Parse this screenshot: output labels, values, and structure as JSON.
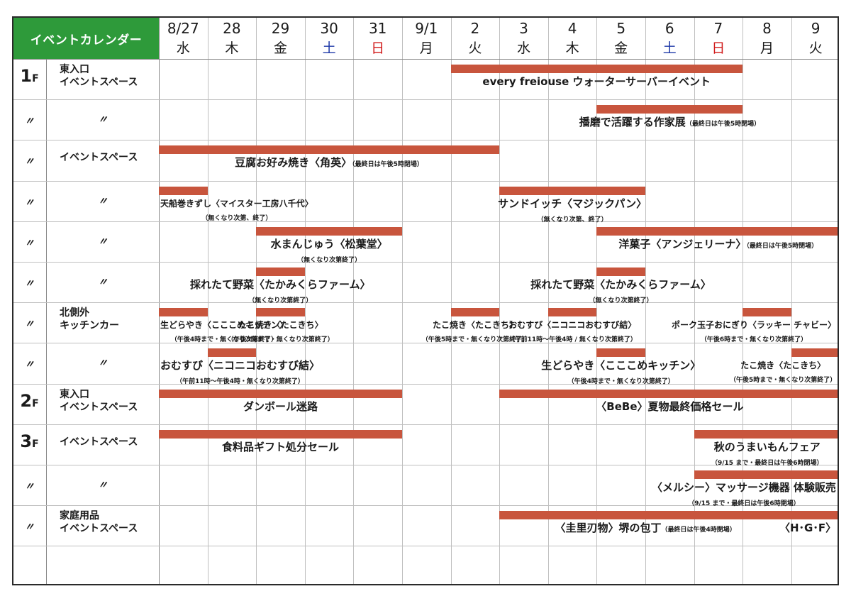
{
  "title": "イベントカレンダー",
  "days": [
    {
      "num": "8/27",
      "dow": "水",
      "color": "#1a1a1a"
    },
    {
      "num": "28",
      "dow": "木",
      "color": "#1a1a1a"
    },
    {
      "num": "29",
      "dow": "金",
      "color": "#1a1a1a"
    },
    {
      "num": "30",
      "dow": "土",
      "color": "#1f3aa8"
    },
    {
      "num": "31",
      "dow": "日",
      "color": "#d01818"
    },
    {
      "num": "9/1",
      "dow": "月",
      "color": "#1a1a1a"
    },
    {
      "num": "2",
      "dow": "火",
      "color": "#1a1a1a"
    },
    {
      "num": "3",
      "dow": "水",
      "color": "#1a1a1a"
    },
    {
      "num": "4",
      "dow": "木",
      "color": "#1a1a1a"
    },
    {
      "num": "5",
      "dow": "金",
      "color": "#1a1a1a"
    },
    {
      "num": "6",
      "dow": "土",
      "color": "#1f3aa8"
    },
    {
      "num": "7",
      "dow": "日",
      "color": "#d01818"
    },
    {
      "num": "8",
      "dow": "月",
      "color": "#1a1a1a"
    },
    {
      "num": "9",
      "dow": "火",
      "color": "#1a1a1a"
    }
  ],
  "rows": [
    {
      "floor": "1",
      "floor_unit": "F",
      "location": "東入口\nイベントスペース"
    },
    {
      "floor": "〃",
      "location": "〃"
    },
    {
      "floor": "〃",
      "location": "イベントスペース"
    },
    {
      "floor": "〃",
      "location": "〃"
    },
    {
      "floor": "〃",
      "location": "〃"
    },
    {
      "floor": "〃",
      "location": "〃"
    },
    {
      "floor": "〃",
      "location": "北側外\nキッチンカー"
    },
    {
      "floor": "〃",
      "location": "〃"
    },
    {
      "floor": "2",
      "floor_unit": "F",
      "location": "東入口\nイベントスペース"
    },
    {
      "floor": "3",
      "floor_unit": "F",
      "location": "イベントスペース"
    },
    {
      "floor": "〃",
      "location": "〃"
    },
    {
      "floor": "〃",
      "location": "家庭用品\nイベントスペース"
    }
  ],
  "bar_color": "#c8553d",
  "events": [
    {
      "row": 0,
      "start": 6,
      "end": 12,
      "label": "every freiouse ウォーターサーバーイベント"
    },
    {
      "row": 1,
      "start": 9,
      "end": 12,
      "label": "播磨で活躍する作家展",
      "note": "（最終日は午後5時閉場）"
    },
    {
      "row": 2,
      "start": 0,
      "end": 7,
      "label": "豆腐お好み焼き〈角英〉",
      "note": "（最終日は午後5時閉場）"
    },
    {
      "row": 3,
      "start": 0,
      "end": 1,
      "label": "天船巻きずし〈マイスター工房八千代〉",
      "sub": "（無くなり次第、終了）",
      "small": true
    },
    {
      "row": 3,
      "start": 7,
      "end": 10,
      "label": "サンドイッチ〈マジックパン〉",
      "sub": "（無くなり次第、終了）"
    },
    {
      "row": 4,
      "start": 2,
      "end": 5,
      "label": "水まんじゅう〈松葉堂〉",
      "sub": "（無くなり次第終了）"
    },
    {
      "row": 4,
      "start": 9,
      "end": 14,
      "label": "洋菓子〈アンジェリーナ〉",
      "note": "（最終日は午後5時閉場）"
    },
    {
      "row": 5,
      "start": 2,
      "end": 3,
      "label": "採れたて野菜〈たかみくらファーム〉",
      "sub": "（無くなり次第終了）"
    },
    {
      "row": 5,
      "start": 9,
      "end": 10,
      "label": "採れたて野菜〈たかみくらファーム〉",
      "sub": "（無くなり次第終了）"
    },
    {
      "row": 6,
      "start": 0,
      "end": 1,
      "label": "生どらやき〈こここめキッチン〉",
      "sub": "（午後4時まで・無くなり次第終了）",
      "small": true
    },
    {
      "row": 6,
      "start": 2,
      "end": 3,
      "label": "たこ焼き〈たこきち〉",
      "sub": "（午後5時まで・無くなり次第終了）",
      "small": true
    },
    {
      "row": 6,
      "start": 6,
      "end": 7,
      "label": "たこ焼き〈たこきち〉",
      "sub": "（午後5時まで・無くなり次第終了）",
      "small": true
    },
    {
      "row": 6,
      "start": 8,
      "end": 9,
      "label": "おむすび〈ニコニコおむすび結〉",
      "sub": "（午前11時～午後4時 / 無くなり次第終了）",
      "small": true
    },
    {
      "row": 6,
      "start": 12,
      "end": 13,
      "label": "ポーク玉子おにぎり〈ラッキー チャビー〉",
      "sub": "（午後6時まで・無くなり次第終了）",
      "small": true
    },
    {
      "row": 7,
      "start": 1,
      "end": 2,
      "label": "おむすび〈ニコニコおむすび結〉",
      "sub": "（午前11時～午後4時・無くなり次第終了）"
    },
    {
      "row": 7,
      "start": 9,
      "end": 10,
      "label": "生どらやき〈こここめキッチン〉",
      "sub": "（午後4時まで・無くなり次第終了）"
    },
    {
      "row": 7,
      "start": 13,
      "end": 14,
      "label": "たこ焼き〈たこきち〉",
      "sub": "（午後5時まで・無くなり次第終了）",
      "small": true
    },
    {
      "row": 8,
      "start": 0,
      "end": 5,
      "label": "ダンボール迷路"
    },
    {
      "row": 8,
      "start": 7,
      "end": 14,
      "label": "〈BeBe〉夏物最終価格セール"
    },
    {
      "row": 9,
      "start": 0,
      "end": 5,
      "label": "食料品ギフト処分セール"
    },
    {
      "row": 9,
      "start": 11,
      "end": 14,
      "label": "秋のうまいもんフェア",
      "sub": "（9/15 まで・最終日は午後6時閉場）"
    },
    {
      "row": 10,
      "start": 11,
      "end": 14,
      "label": "〈メルシー〉マッサージ機器 体験販売",
      "sub": "（9/15 まで・最終日は午後6時閉場）"
    },
    {
      "row": 11,
      "start": 7,
      "end": 13,
      "label": "〈圭里刃物〉堺の包丁",
      "note": "（最終日は午後4時閉場）"
    },
    {
      "row": 11,
      "start": 13,
      "end": 14,
      "label": "〈H･G･F〉"
    }
  ]
}
